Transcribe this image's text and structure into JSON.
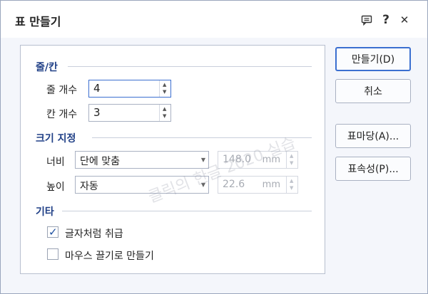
{
  "window": {
    "title": "표 만들기",
    "controls": {
      "help_label": "?",
      "close_label": "✕"
    }
  },
  "rows_cols": {
    "heading": "줄/칸",
    "rows_label": "줄 개수",
    "rows_value": "4",
    "cols_label": "칸 개수",
    "cols_value": "3"
  },
  "size": {
    "heading": "크기 지정",
    "width_label": "너비",
    "width_mode": "단에 맞춤",
    "width_value": "148.0",
    "width_unit": "mm",
    "height_label": "높이",
    "height_mode": "자동",
    "height_value": "22.6",
    "height_unit": "mm"
  },
  "other": {
    "heading": "기타",
    "treat_as_char_label": "글자처럼 취급",
    "treat_as_char_checked": true,
    "drag_create_label": "마우스 끌기로 만들기",
    "drag_create_checked": false
  },
  "buttons": {
    "create": "만들기(D)",
    "cancel": "취소",
    "table_style": "표마당(A)...",
    "table_props": "표속성(P)..."
  },
  "watermark_text": "클릭의 한글 2020 실습"
}
